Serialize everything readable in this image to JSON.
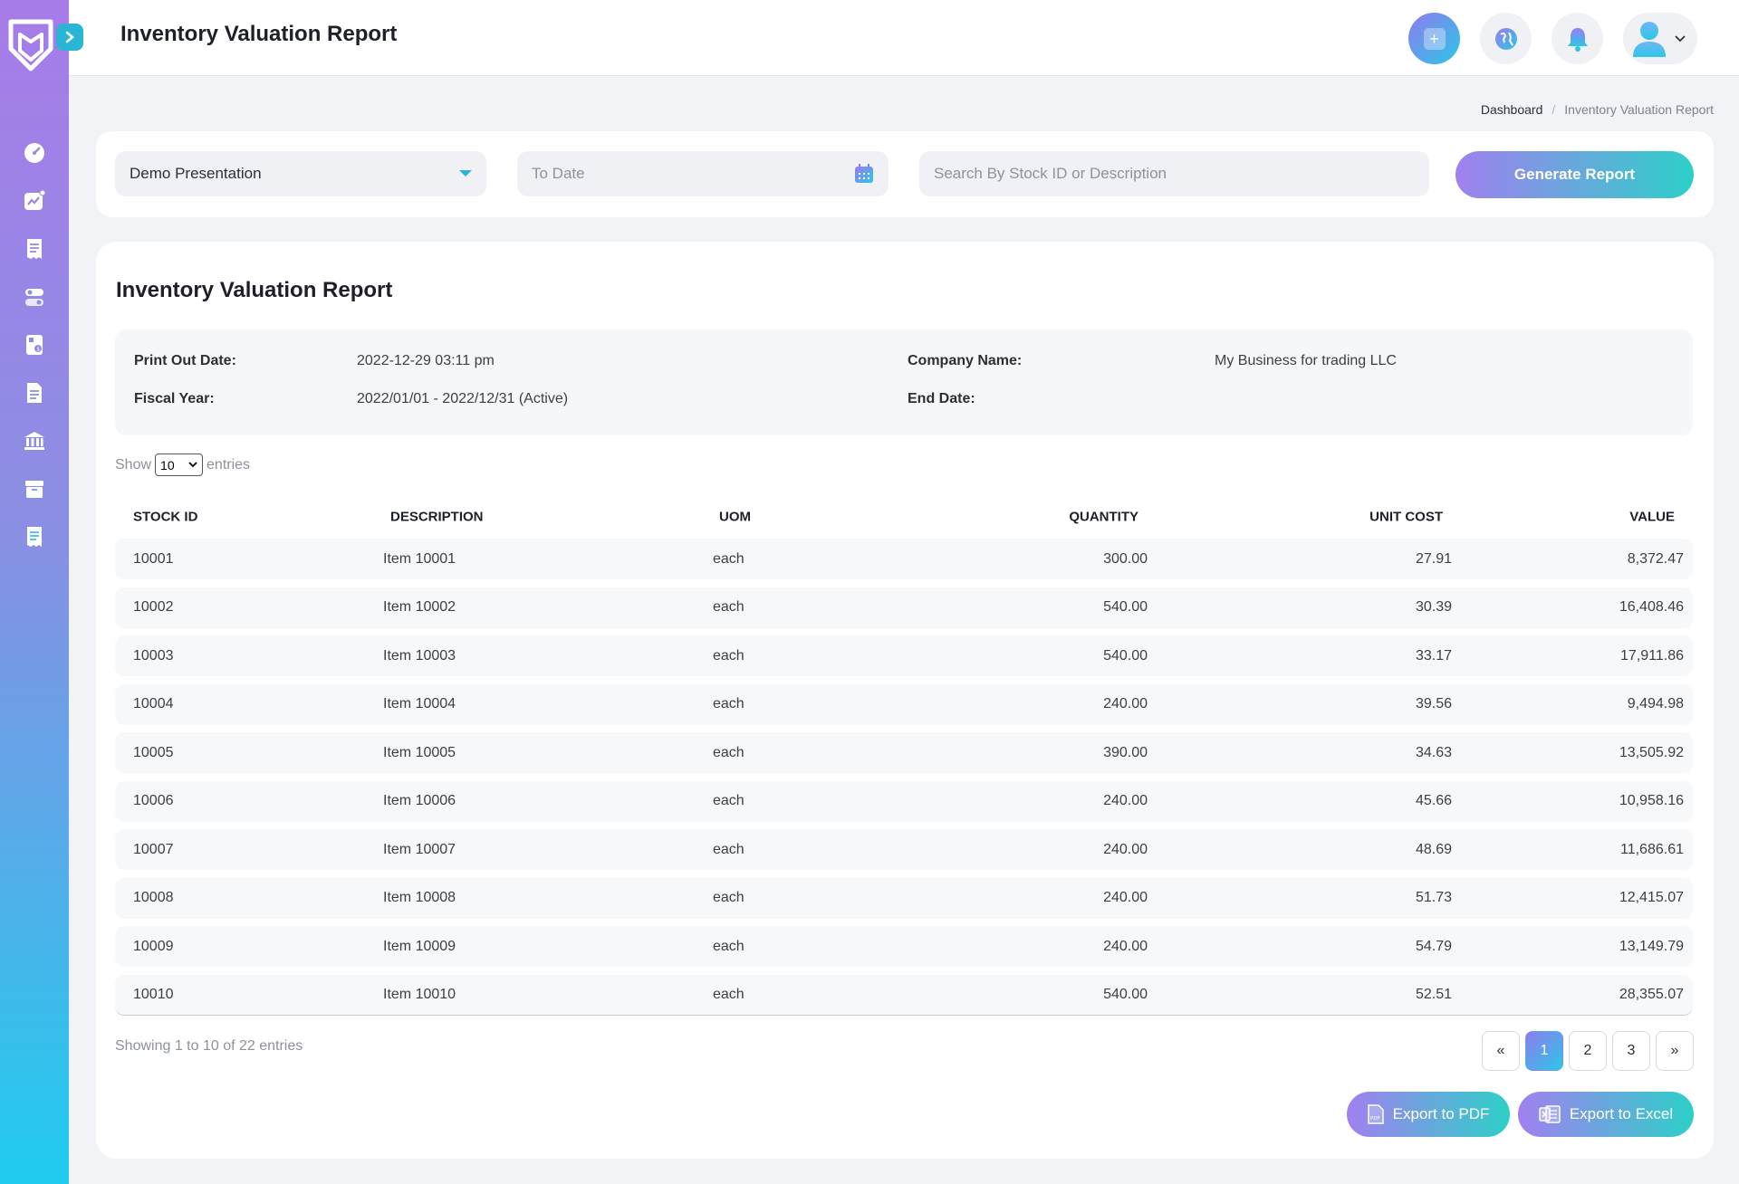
{
  "app": {
    "page_title": "Inventory Valuation Report"
  },
  "breadcrumb": {
    "home": "Dashboard",
    "separator": "/",
    "current": "Inventory Valuation Report"
  },
  "filters": {
    "company": "Demo Presentation",
    "date_placeholder": "To Date",
    "search_placeholder": "Search By Stock ID or Description",
    "generate_label": "Generate Report"
  },
  "report": {
    "title": "Inventory Valuation Report",
    "info": {
      "print_out_date_label": "Print Out Date:",
      "print_out_date": "2022-12-29 03:11 pm",
      "fiscal_year_label": "Fiscal Year:",
      "fiscal_year": "2022/01/01 - 2022/12/31 (Active)",
      "company_name_label": "Company Name:",
      "company_name": "My Business for trading LLC",
      "end_date_label": "End Date:",
      "end_date": ""
    },
    "entries": {
      "show": "Show",
      "value": "10",
      "suffix": "entries"
    },
    "columns": [
      "STOCK ID",
      "DESCRIPTION",
      "UOM",
      "QUANTITY",
      "UNIT COST",
      "VALUE"
    ],
    "rows": [
      {
        "id": "10001",
        "desc": "Item 10001",
        "uom": "each",
        "qty": "300.00",
        "cost": "27.91",
        "value": "8,372.47"
      },
      {
        "id": "10002",
        "desc": "Item 10002",
        "uom": "each",
        "qty": "540.00",
        "cost": "30.39",
        "value": "16,408.46"
      },
      {
        "id": "10003",
        "desc": "Item 10003",
        "uom": "each",
        "qty": "540.00",
        "cost": "33.17",
        "value": "17,911.86"
      },
      {
        "id": "10004",
        "desc": "Item 10004",
        "uom": "each",
        "qty": "240.00",
        "cost": "39.56",
        "value": "9,494.98"
      },
      {
        "id": "10005",
        "desc": "Item 10005",
        "uom": "each",
        "qty": "390.00",
        "cost": "34.63",
        "value": "13,505.92"
      },
      {
        "id": "10006",
        "desc": "Item 10006",
        "uom": "each",
        "qty": "240.00",
        "cost": "45.66",
        "value": "10,958.16"
      },
      {
        "id": "10007",
        "desc": "Item 10007",
        "uom": "each",
        "qty": "240.00",
        "cost": "48.69",
        "value": "11,686.61"
      },
      {
        "id": "10008",
        "desc": "Item 10008",
        "uom": "each",
        "qty": "240.00",
        "cost": "51.73",
        "value": "12,415.07"
      },
      {
        "id": "10009",
        "desc": "Item 10009",
        "uom": "each",
        "qty": "240.00",
        "cost": "54.79",
        "value": "13,149.79"
      },
      {
        "id": "10010",
        "desc": "Item 10010",
        "uom": "each",
        "qty": "540.00",
        "cost": "52.51",
        "value": "28,355.07"
      }
    ],
    "showing": "Showing 1 to 10 of 22 entries",
    "pagination": {
      "prev": "«",
      "pages": [
        "1",
        "2",
        "3"
      ],
      "next": "»",
      "active": "1"
    },
    "export_pdf": "Export to PDF",
    "export_excel": "Export to Excel"
  },
  "icons": {
    "sidebar": [
      "dashboard-icon",
      "chart-icon",
      "receipt-icon",
      "toggle-icon",
      "calculator-icon",
      "document-icon",
      "bank-icon",
      "box-icon",
      "invoice-icon"
    ],
    "topbar": [
      "add-icon",
      "globe-icon",
      "bell-icon",
      "user-icon",
      "chevron-down-icon"
    ]
  },
  "colors": {
    "accent_start": "#a180f0",
    "accent_end": "#2dd0c8",
    "sidebar_top": "#a77ce8",
    "sidebar_bottom": "#1fcbef"
  }
}
